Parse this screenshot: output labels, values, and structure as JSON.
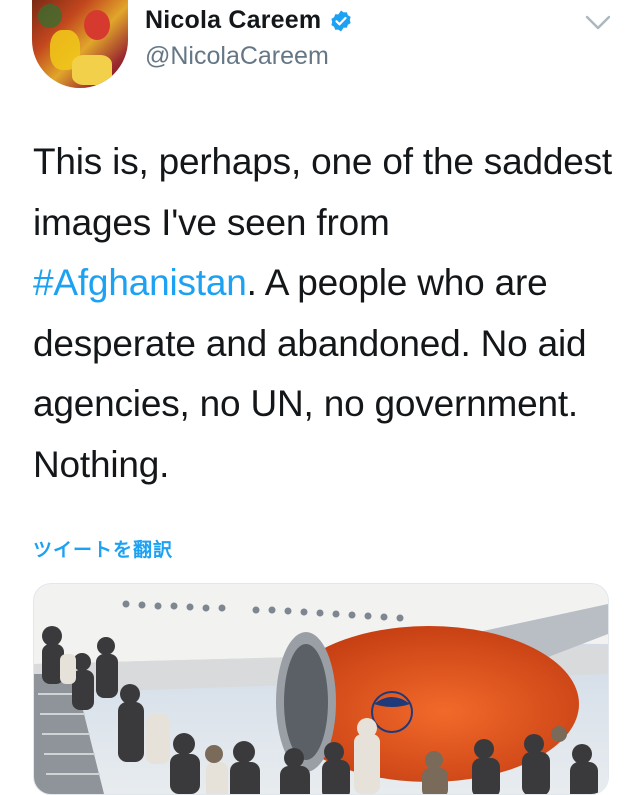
{
  "author": {
    "display_name": "Nicola Careem",
    "handle": "@NicolaCareem",
    "verified": true,
    "verified_badge_color": "#1da1f2"
  },
  "tweet": {
    "text_before_hashtag": "This is, perhaps, one of the saddest images I've seen from ",
    "hashtag": "#Afghanistan",
    "text_after_hashtag": ".  A people who are desperate and abandoned.  No aid agencies, no UN, no government.  Nothing."
  },
  "translate_label": "ツイートを翻訳",
  "colors": {
    "link": "#1da1f2",
    "text": "#14171a",
    "secondary_text": "#657786",
    "engine": "#e8541e"
  },
  "icons": {
    "more": "chevron-down-icon",
    "verified": "verified-badge-icon"
  }
}
